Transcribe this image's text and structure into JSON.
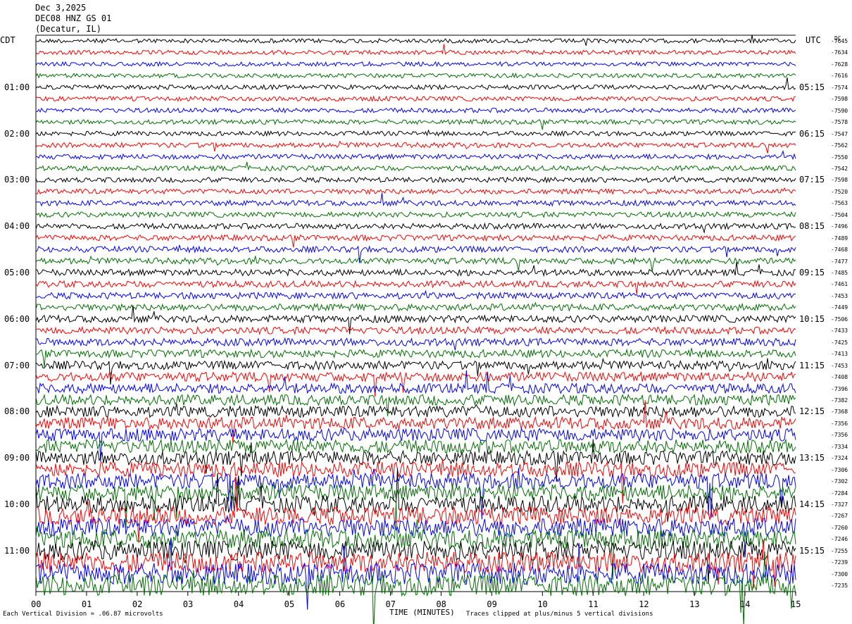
{
  "header": {
    "date": "Dec 3,2025",
    "station": "DEC08 HNZ GS 01",
    "location": "(Decatur, IL)"
  },
  "left_tz": "CDT",
  "right_tz": "UTC",
  "right_top_label": "DC",
  "footer": {
    "left": "Each Vertical Division = .06.87 microvolts",
    "xlabel": "TIME (MINUTES)",
    "right": "Traces clipped at plus/minus 5 vertical divisions"
  },
  "colors": {
    "cycle": [
      "#000000",
      "#ff0000",
      "#0000ff",
      "#007000"
    ],
    "background": "#ffffff"
  },
  "chart_data": {
    "type": "line",
    "title": "DEC08 HNZ GS 01",
    "xlabel": "TIME (MINUTES)",
    "x_range": [
      0,
      15
    ],
    "x_ticks": [
      "00",
      "01",
      "02",
      "03",
      "04",
      "05",
      "06",
      "07",
      "08",
      "09",
      "10",
      "11",
      "12",
      "13",
      "14",
      "15"
    ],
    "trace_count": 48,
    "trace_minutes": 15,
    "left_hour_labels": [
      "01:00",
      "02:00",
      "03:00",
      "04:00",
      "05:00",
      "06:00",
      "07:00",
      "08:00",
      "09:00",
      "10:00",
      "11:00"
    ],
    "right_hour_labels": [
      "05:15",
      "06:15",
      "07:15",
      "08:15",
      "09:15",
      "10:15",
      "11:15",
      "12:15",
      "13:15",
      "14:15",
      "15:15"
    ],
    "trace_offsets": [
      "-7645",
      "-7634",
      "-7628",
      "-7616",
      "-7574",
      "-7598",
      "-7590",
      "-7578",
      "-7547",
      "-7562",
      "-7550",
      "-7542",
      "-7598",
      "-7520",
      "-7563",
      "-7504",
      "-7496",
      "-7489",
      "-7468",
      "-7477",
      "-7485",
      "-7461",
      "-7453",
      "-7449",
      "-7506",
      "-7433",
      "-7425",
      "-7413",
      "-7453",
      "-7408",
      "-7396",
      "-7382",
      "-7368",
      "-7356",
      "-7356",
      "-7334",
      "-7324",
      "-7306",
      "-7302",
      "-7284",
      "-7327",
      "-7267",
      "-7260",
      "-7246",
      "-7255",
      "-7239",
      "-7300",
      "-7235"
    ],
    "noise_level": [
      0.6,
      0.6,
      0.6,
      0.6,
      0.65,
      0.65,
      0.65,
      0.65,
      0.65,
      0.7,
      0.7,
      0.7,
      0.7,
      0.7,
      0.75,
      0.75,
      0.8,
      0.8,
      0.85,
      0.85,
      0.9,
      0.9,
      0.9,
      0.95,
      1.0,
      1.0,
      1.05,
      1.1,
      1.2,
      1.3,
      1.4,
      1.5,
      1.6,
      1.7,
      1.8,
      1.9,
      2.0,
      2.1,
      2.2,
      2.3,
      2.4,
      2.5,
      2.6,
      2.7,
      2.8,
      2.9,
      3.0,
      3.0
    ]
  }
}
